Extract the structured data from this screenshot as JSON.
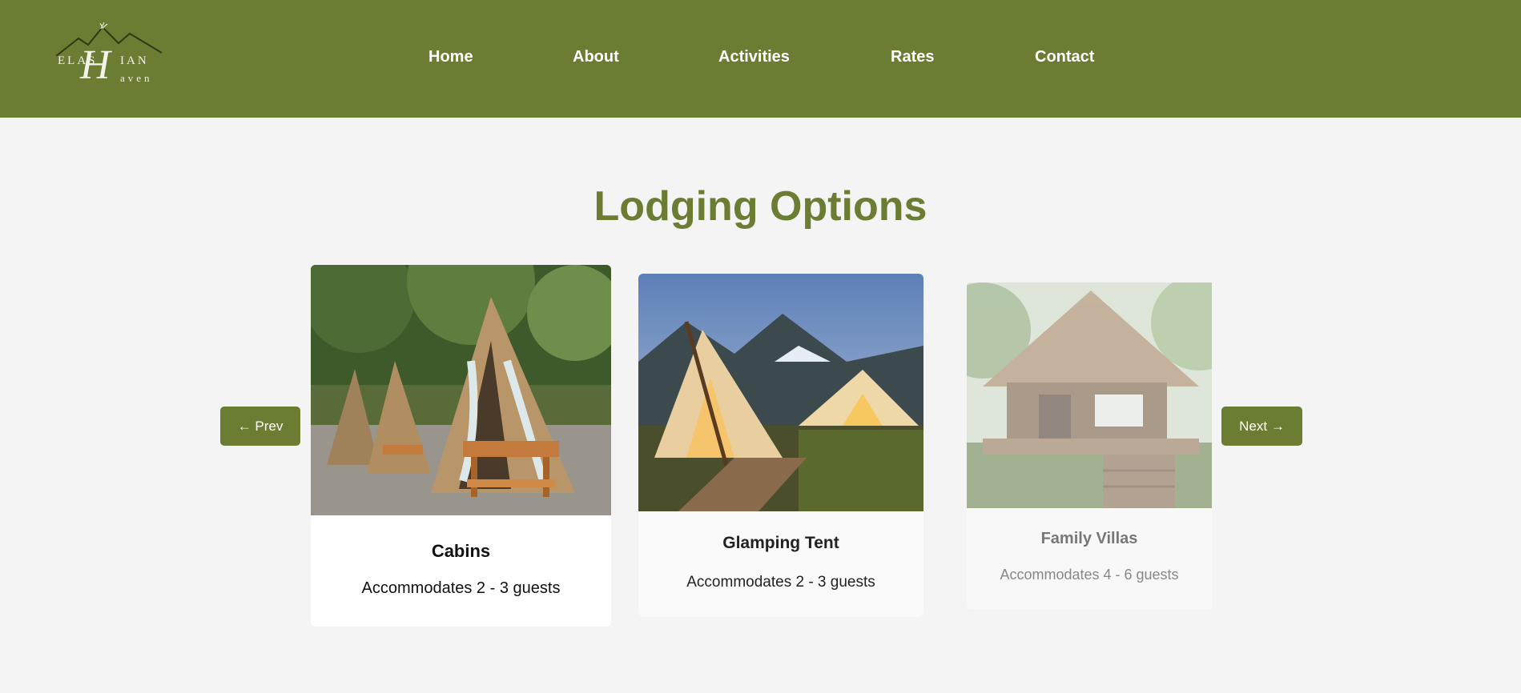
{
  "logo": {
    "line1": "ELAS",
    "line2": "IAN",
    "script_letter": "H",
    "line3": "aven"
  },
  "nav": {
    "items": [
      "Home",
      "About",
      "Activities",
      "Rates",
      "Contact"
    ]
  },
  "section": {
    "title": "Lodging Options"
  },
  "carousel": {
    "prev_label": "← Prev",
    "next_label": "Next →",
    "cards": [
      {
        "title": "Cabins",
        "subtitle": "Accommodates 2 - 3 guests",
        "image": "thatched-a-frame-cabins-photo"
      },
      {
        "title": "Glamping Tent",
        "subtitle": "Accommodates 2 - 3 guests",
        "image": "glamping-tents-at-dusk-photo"
      },
      {
        "title": "Family Villas",
        "subtitle": "Accommodates 4 - 6 guests",
        "image": "tropical-wooden-villa-photo"
      }
    ]
  },
  "colors": {
    "brand_green": "#6a7d33",
    "page_bg": "#f4f4f4",
    "card_bg": "#ffffff"
  }
}
